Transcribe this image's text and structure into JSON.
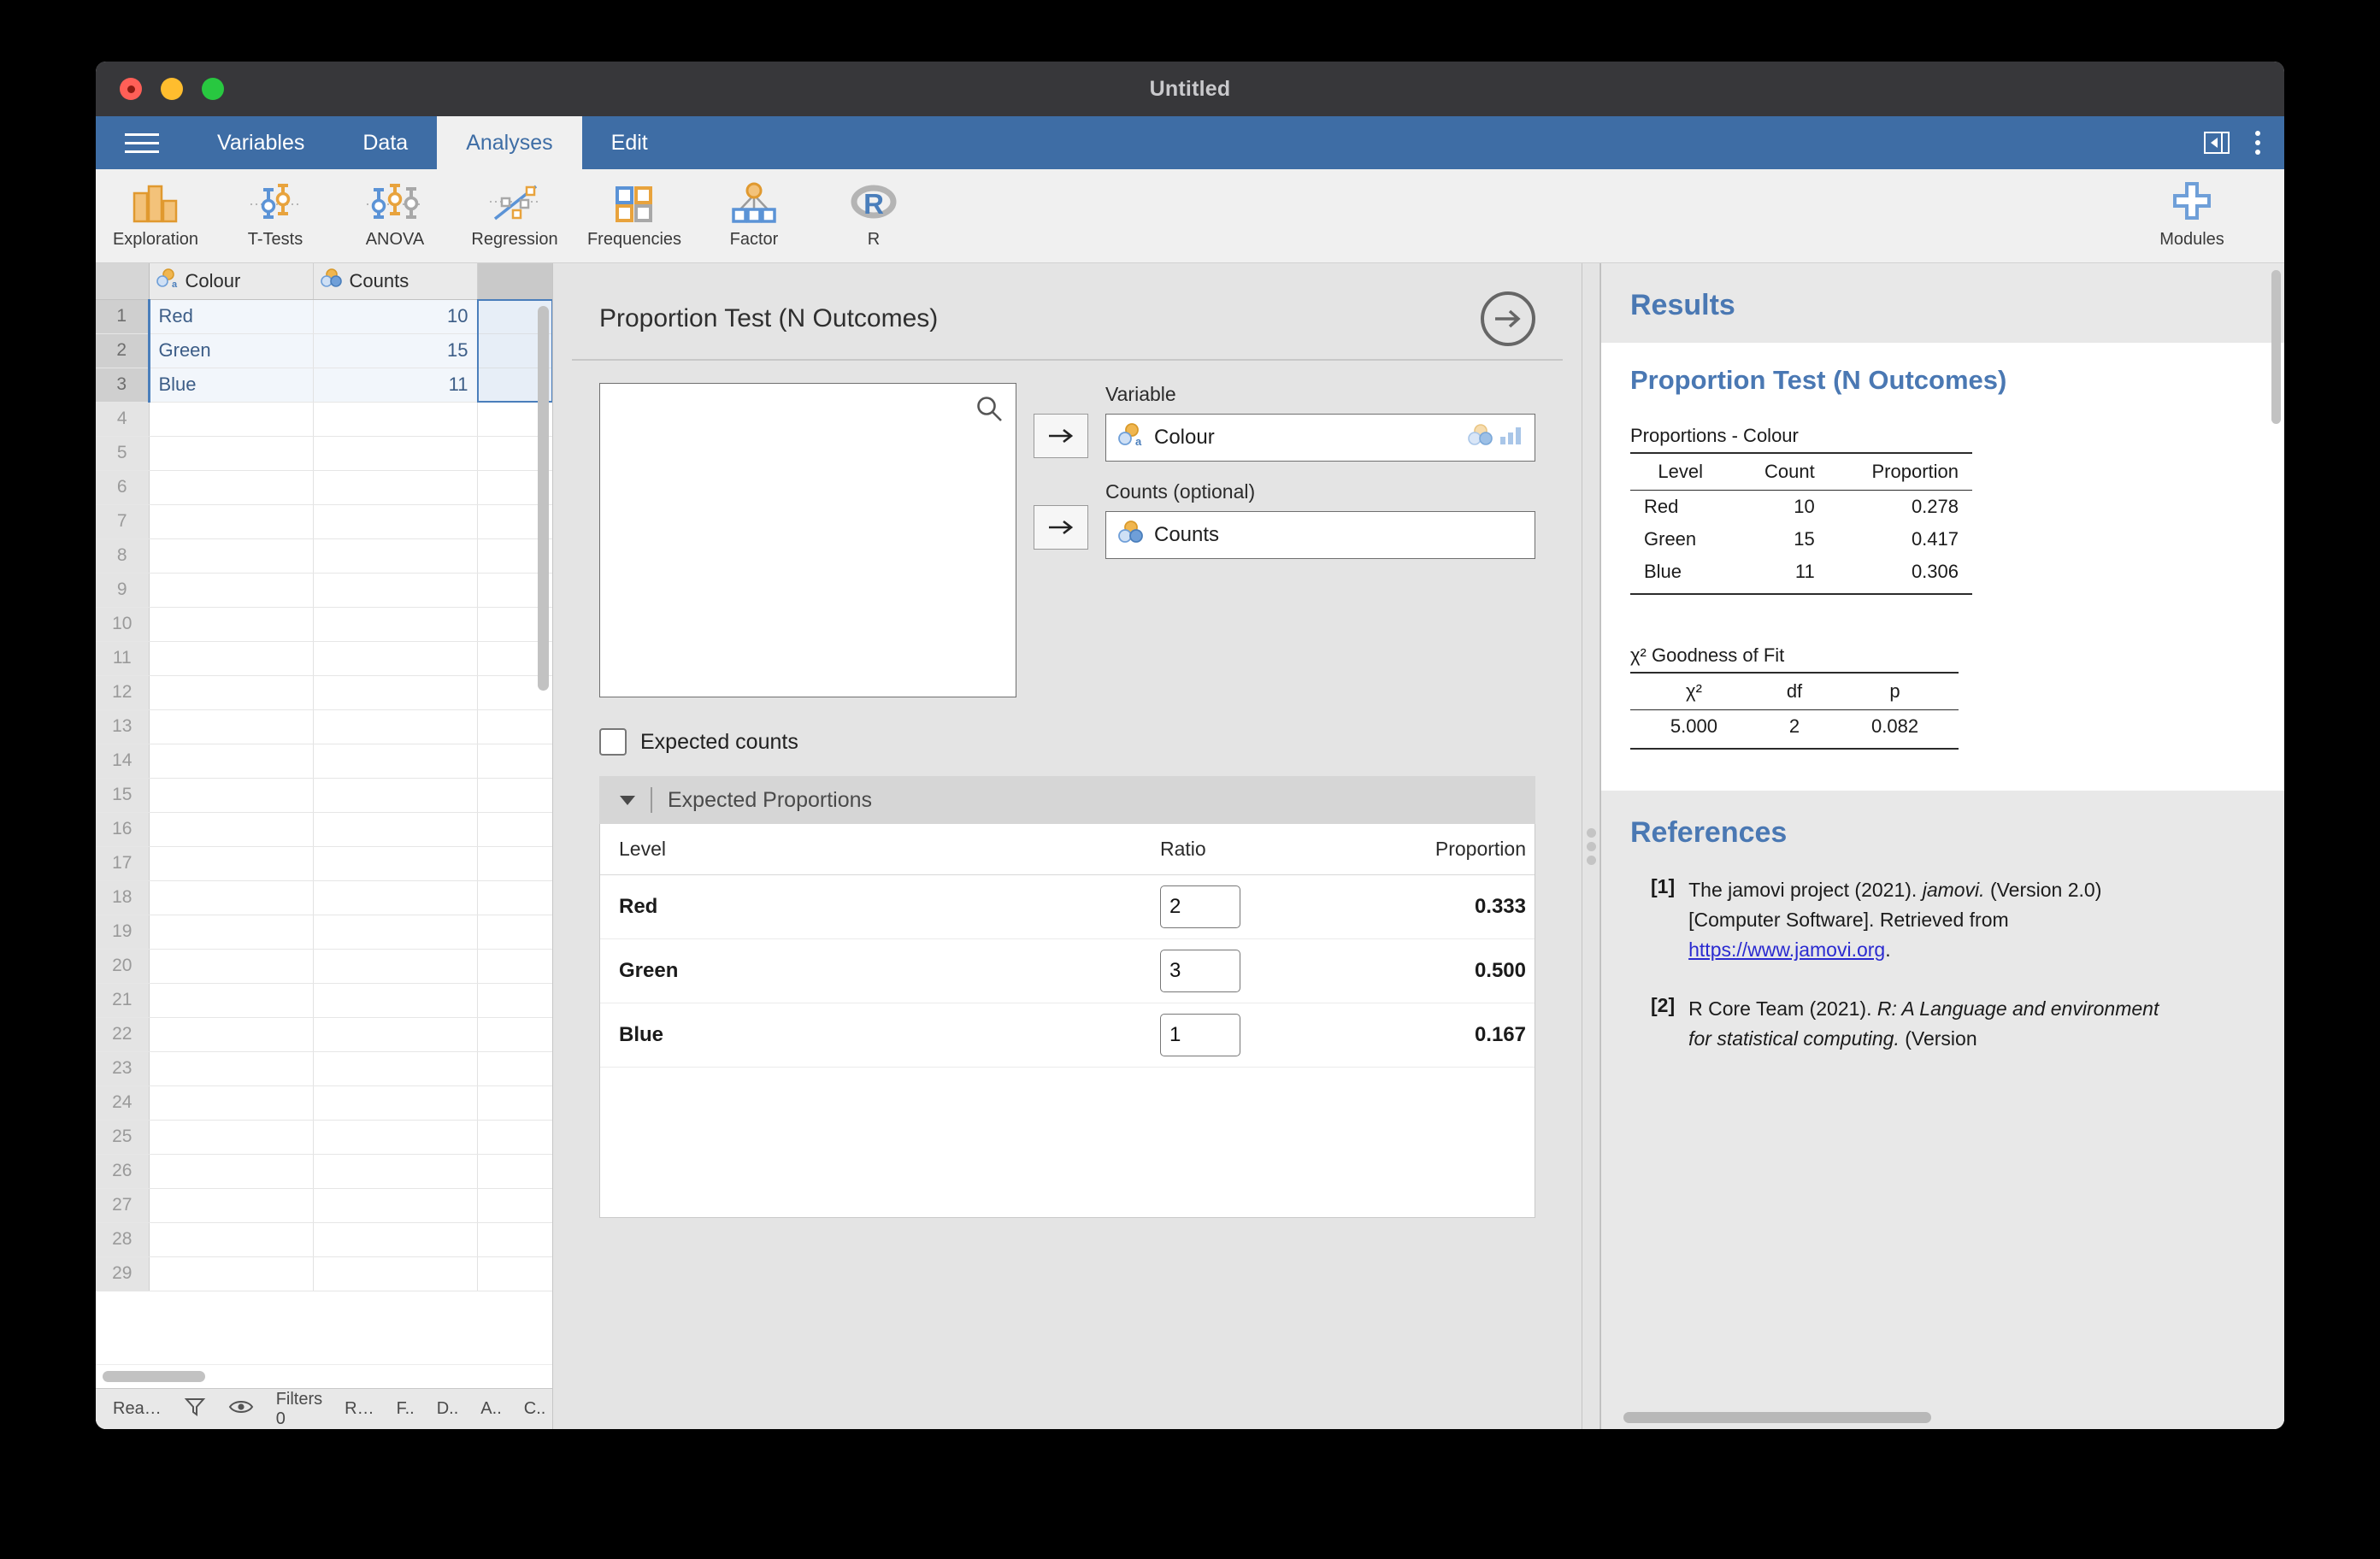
{
  "window": {
    "title": "Untitled"
  },
  "tabs": [
    {
      "label": "Variables",
      "active": false
    },
    {
      "label": "Data",
      "active": false
    },
    {
      "label": "Analyses",
      "active": true
    },
    {
      "label": "Edit",
      "active": false
    }
  ],
  "ribbon": {
    "buttons": [
      {
        "label": "Exploration",
        "icon": "bar-chart-icon"
      },
      {
        "label": "T-Tests",
        "icon": "ttest-icon"
      },
      {
        "label": "ANOVA",
        "icon": "anova-icon"
      },
      {
        "label": "Regression",
        "icon": "regression-icon"
      },
      {
        "label": "Frequencies",
        "icon": "frequencies-icon"
      },
      {
        "label": "Factor",
        "icon": "factor-icon"
      },
      {
        "label": "R",
        "icon": "r-icon"
      }
    ],
    "modules_label": "Modules"
  },
  "spreadsheet": {
    "columns": [
      {
        "name": "Colour",
        "type": "nominal-text"
      },
      {
        "name": "Counts",
        "type": "nominal"
      }
    ],
    "rows": [
      {
        "n": "1",
        "colour": "Red",
        "counts": "10"
      },
      {
        "n": "2",
        "colour": "Green",
        "counts": "15"
      },
      {
        "n": "3",
        "colour": "Blue",
        "counts": "11"
      }
    ],
    "empty_row_numbers": [
      "4",
      "5",
      "6",
      "7",
      "8",
      "9",
      "10",
      "11",
      "12",
      "13",
      "14",
      "15",
      "16",
      "17",
      "18",
      "19",
      "20",
      "21",
      "22",
      "23",
      "24",
      "25",
      "26",
      "27",
      "28",
      "29"
    ],
    "status": {
      "ready": "Rea…",
      "filter_icon": "filter-icon",
      "eye_icon": "eye-icon",
      "filters": "Filters 0",
      "abbrev": [
        "R…",
        "F..",
        "D..",
        "A..",
        "C.."
      ]
    }
  },
  "options": {
    "title": "Proportion Test (N Outcomes)",
    "variable_list_items": [],
    "search_icon": "search-icon",
    "fields": [
      {
        "label": "Variable",
        "value": "Colour",
        "icon": "nominal-text-icon",
        "suffix_icons": [
          "nominal-icon",
          "bar-chart-icon"
        ]
      },
      {
        "label": "Counts (optional)",
        "value": "Counts",
        "icon": "nominal-icon",
        "suffix_icons": []
      }
    ],
    "expected_counts": {
      "label": "Expected counts",
      "checked": false
    },
    "expected_proportions": {
      "section_label": "Expected Proportions",
      "expanded": true,
      "headers": [
        "Level",
        "Ratio",
        "Proportion"
      ],
      "rows": [
        {
          "level": "Red",
          "ratio": "2",
          "proportion": "0.333"
        },
        {
          "level": "Green",
          "ratio": "3",
          "proportion": "0.500"
        },
        {
          "level": "Blue",
          "ratio": "1",
          "proportion": "0.167"
        }
      ]
    }
  },
  "results": {
    "panel_title": "Results",
    "analysis_title": "Proportion Test (N Outcomes)",
    "proportions_table": {
      "caption": "Proportions - Colour",
      "headers": [
        "Level",
        "Count",
        "Proportion"
      ],
      "rows": [
        {
          "level": "Red",
          "count": "10",
          "proportion": "0.278"
        },
        {
          "level": "Green",
          "count": "15",
          "proportion": "0.417"
        },
        {
          "level": "Blue",
          "count": "11",
          "proportion": "0.306"
        }
      ]
    },
    "gof_table": {
      "caption": "χ² Goodness of Fit",
      "headers": [
        "χ²",
        "df",
        "p"
      ],
      "rows": [
        {
          "chisq": "5.000",
          "df": "2",
          "p": "0.082"
        }
      ]
    },
    "references_title": "References",
    "references": [
      {
        "num": "[1]",
        "pre": "The jamovi project (2021). ",
        "italic": "jamovi.",
        "mid": " (Version 2.0) [Computer Software]. Retrieved from ",
        "link": "https://www.jamovi.org",
        "post": "."
      },
      {
        "num": "[2]",
        "pre": "R Core Team (2021). ",
        "italic": "R: A Language and environment for statistical computing.",
        "mid": " (Version",
        "link": "",
        "post": ""
      }
    ]
  },
  "colors": {
    "accent_blue": "#3e6da5",
    "results_blue": "#4a78b3",
    "orange": "#e8a33d",
    "icon_blue": "#6f9fd8",
    "cell_text": "#3c5d87"
  }
}
